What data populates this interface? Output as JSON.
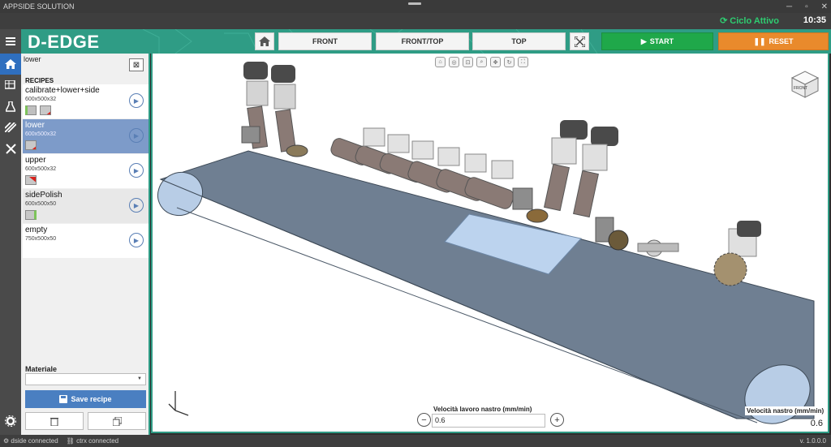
{
  "window": {
    "title": "APPSIDE SOLUTION"
  },
  "topbar": {
    "status": "Ciclo Attivo",
    "time": "10:35"
  },
  "header": {
    "brand": "D-EDGE",
    "views": [
      "FRONT",
      "FRONT/TOP",
      "TOP"
    ],
    "start_label": "START",
    "reset_label": "RESET"
  },
  "panel": {
    "search_value": "lower",
    "recipes_title": "RECIPES",
    "recipes": [
      {
        "name": "calibrate+lower+side",
        "size": "600x500x32"
      },
      {
        "name": "lower",
        "size": "600x500x32"
      },
      {
        "name": "upper",
        "size": "600x500x32"
      },
      {
        "name": "sidePolish",
        "size": "600x500x50"
      },
      {
        "name": "empty",
        "size": "750x500x50"
      }
    ],
    "material_label": "Materiale",
    "material_value": "",
    "save_label": "Save recipe"
  },
  "viewport": {
    "speed_label": "Velocità lavoro nastro (mm/min)",
    "speed_value": "0.6",
    "speed_right_label": "Velocità nastro (mm/min)",
    "speed_right_value": "0.6",
    "cube_label": "FRONT"
  },
  "statusbar": {
    "dside": "dside connected",
    "ctrx": "ctrx connected",
    "version": "v. 1.0.0.0"
  },
  "colors": {
    "accent": "#2f9c85",
    "start": "#1fa84a",
    "reset": "#e98a2c",
    "selection": "#7d9bc9",
    "belt": "#6f7f92"
  }
}
